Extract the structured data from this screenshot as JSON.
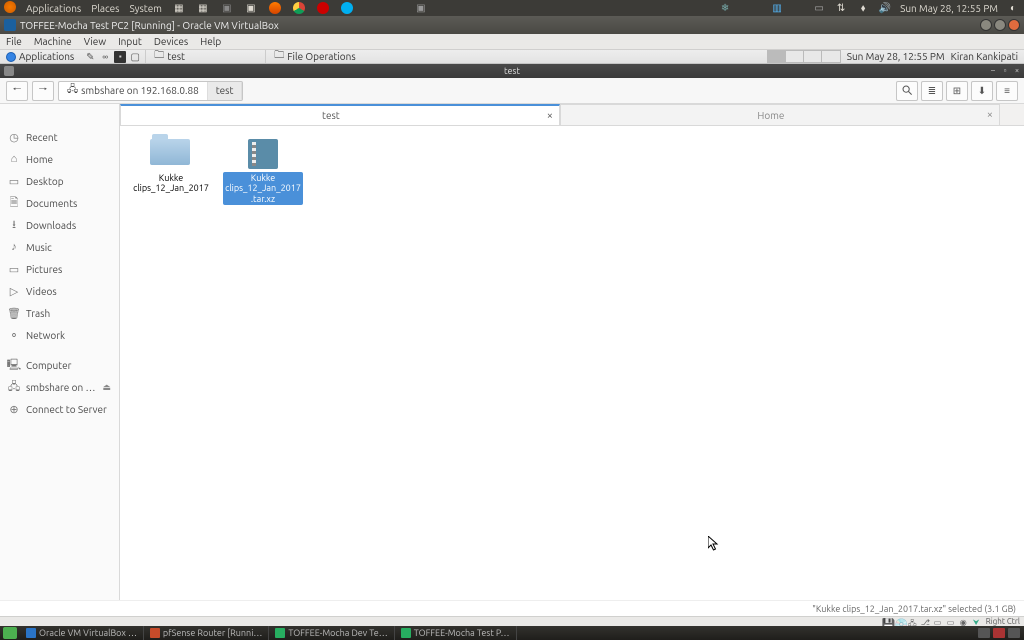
{
  "host_top": {
    "menus": [
      "Applications",
      "Places",
      "System"
    ],
    "time": "Sun May 28, 12:55 PM"
  },
  "vm_titlebar": {
    "title": "TOFFEE-Mocha Test PC2 [Running] - Oracle VM VirtualBox"
  },
  "vm_menus": [
    "File",
    "Machine",
    "View",
    "Input",
    "Devices",
    "Help"
  ],
  "guest_top": {
    "applications_label": "Applications",
    "task1": "test",
    "task2": "File Operations",
    "time": "Sun May 28, 12:55 PM",
    "user": "Kiran Kankipati"
  },
  "nautilus": {
    "title": "test",
    "path": {
      "share_label": "smbshare on 192.168.0.88",
      "current": "test"
    },
    "tabs": [
      {
        "label": "test",
        "active": true
      },
      {
        "label": "Home",
        "active": false
      }
    ],
    "sidebar": [
      {
        "icon": "clock-icon",
        "glyph": "◷",
        "label": "Recent"
      },
      {
        "icon": "home-icon",
        "glyph": "⌂",
        "label": "Home"
      },
      {
        "icon": "desktop-icon",
        "glyph": "▭",
        "label": "Desktop"
      },
      {
        "icon": "documents-icon",
        "glyph": "🗎",
        "label": "Documents"
      },
      {
        "icon": "downloads-icon",
        "glyph": "⭳",
        "label": "Downloads"
      },
      {
        "icon": "music-icon",
        "glyph": "♪",
        "label": "Music"
      },
      {
        "icon": "pictures-icon",
        "glyph": "▭",
        "label": "Pictures"
      },
      {
        "icon": "videos-icon",
        "glyph": "▷",
        "label": "Videos"
      },
      {
        "icon": "trash-icon",
        "glyph": "🗑",
        "label": "Trash"
      },
      {
        "icon": "network-icon",
        "glyph": "⚬",
        "label": "Network"
      }
    ],
    "sidebar_extra": {
      "computer": "Computer",
      "smb": "smbshare on …",
      "connect": "Connect to Server"
    },
    "files": [
      {
        "type": "folder",
        "name": "Kukke clips_12_Jan_2017",
        "selected": false
      },
      {
        "type": "archive",
        "name": "Kukke clips_12_Jan_2017.tar.xz",
        "selected": true
      }
    ],
    "status": "\"Kukke clips_12_Jan_2017.tar.xz\" selected (3.1 GB)"
  },
  "vm_status_hint": "Right Ctrl",
  "host_tasks": [
    {
      "label": "Oracle VM VirtualBox …",
      "color": "#2a74c7"
    },
    {
      "label": "pfSense Router [Runni…",
      "color": "#c74b2a"
    },
    {
      "label": "TOFFEE-Mocha Dev Te…",
      "color": "#27ae60"
    },
    {
      "label": "TOFFEE-Mocha Test P…",
      "color": "#27ae60"
    }
  ]
}
